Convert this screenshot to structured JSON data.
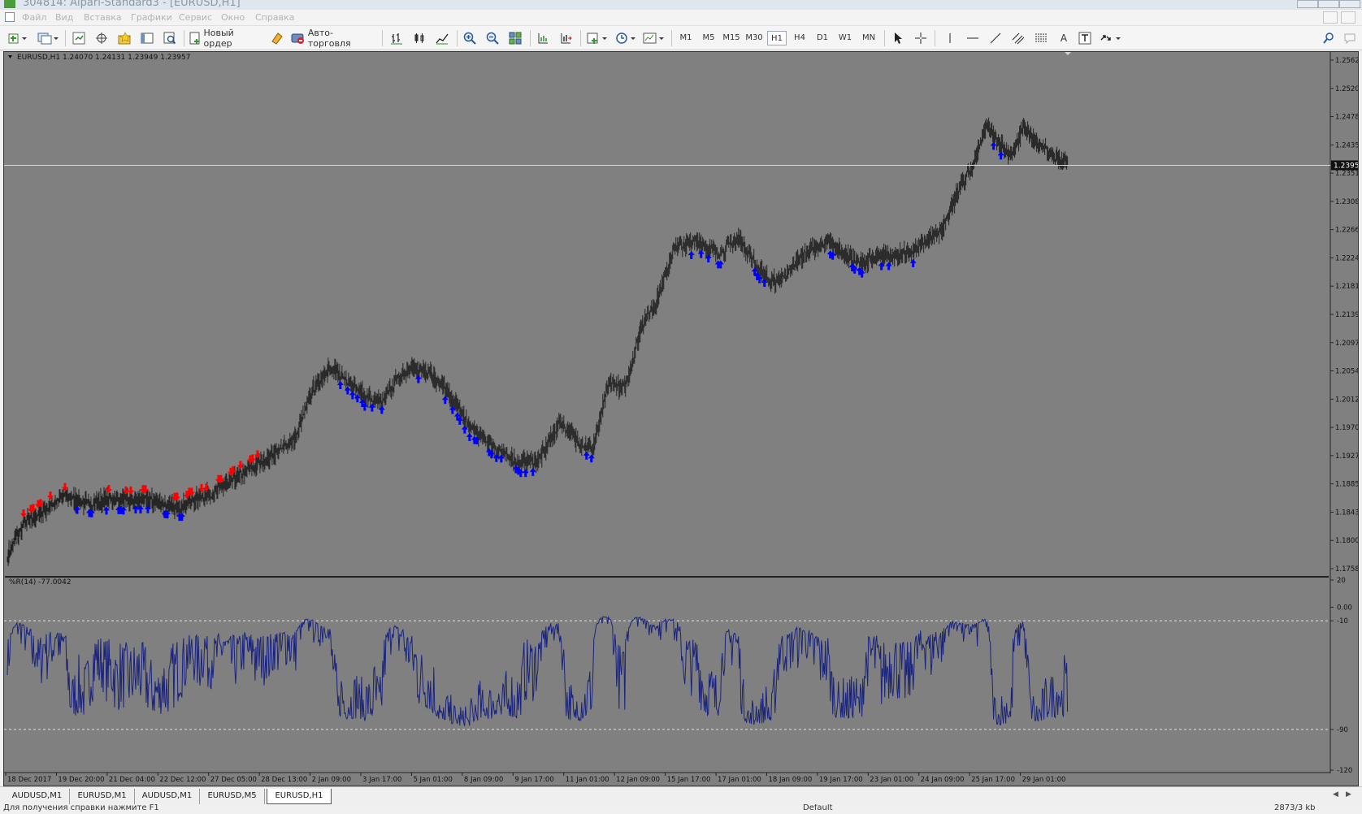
{
  "window": {
    "title": "304814: Alpari-Standard3 - [EURUSD,H1]"
  },
  "menu": {
    "items": [
      "Файл",
      "Вид",
      "Вставка",
      "Графики",
      "Сервис",
      "Окно",
      "Справка"
    ]
  },
  "toolbar": {
    "new_order_label": "Новый ордер",
    "auto_trading_label": "Авто-торговля",
    "timeframes": [
      "M1",
      "M5",
      "M15",
      "M30",
      "H1",
      "H4",
      "D1",
      "W1",
      "MN"
    ],
    "selected_timeframe": "H1",
    "text_tool_label": "A"
  },
  "chart": {
    "header": "EURUSD,H1  1.24070 1.24131 1.23949 1.23957",
    "current_price_label": "1.23957",
    "price_axis_labels": [
      "1.25620",
      "1.25200",
      "1.24780",
      "1.24350",
      "1.23510",
      "1.23080",
      "1.22660",
      "1.22240",
      "1.21810",
      "1.21390",
      "1.20970",
      "1.20540",
      "1.20120",
      "1.19700",
      "1.19270",
      "1.18850",
      "1.18430",
      "1.18000",
      "1.17580"
    ],
    "indicator_header": "%R(14) -77.0042",
    "indicator_axis_labels": [
      "20",
      "0.00",
      "-10",
      "-90",
      "-120"
    ],
    "time_axis_labels": [
      "18 Dec 2017",
      "19 Dec 20:00",
      "21 Dec 04:00",
      "22 Dec 12:00",
      "27 Dec 05:00",
      "28 Dec 13:00",
      "2 Jan 09:00",
      "3 Jan 17:00",
      "5 Jan 01:00",
      "8 Jan 09:00",
      "9 Jan 17:00",
      "11 Jan 01:00",
      "12 Jan 09:00",
      "15 Jan 17:00",
      "17 Jan 01:00",
      "18 Jan 09:00",
      "19 Jan 17:00",
      "23 Jan 01:00",
      "24 Jan 09:00",
      "25 Jan 17:00",
      "29 Jan 01:00"
    ],
    "colors": {
      "background": "#808080",
      "bars": "#222222",
      "buy_arrow": "#0000ff",
      "sell_arrow": "#ff0000",
      "indicator_line": "#1a237e",
      "level_line": "#e0e0e0"
    }
  },
  "chart_data": {
    "type": "line",
    "series": [
      {
        "name": "EURUSD,H1",
        "kind": "price",
        "x_start": "18 Dec 2017",
        "x_end": "29 Jan 01:00",
        "keypoints": [
          [
            0,
            1.178
          ],
          [
            20,
            1.183
          ],
          [
            45,
            1.185
          ],
          [
            70,
            1.1875
          ],
          [
            95,
            1.186
          ],
          [
            125,
            1.1868
          ],
          [
            150,
            1.1865
          ],
          [
            170,
            1.1868
          ],
          [
            185,
            1.1862
          ],
          [
            200,
            1.1855
          ],
          [
            215,
            1.1858
          ],
          [
            235,
            1.187
          ],
          [
            255,
            1.188
          ],
          [
            275,
            1.1895
          ],
          [
            290,
            1.191
          ],
          [
            310,
            1.1925
          ],
          [
            330,
            1.194
          ],
          [
            355,
            1.1965
          ],
          [
            375,
            1.204
          ],
          [
            395,
            1.2075
          ],
          [
            415,
            1.206
          ],
          [
            440,
            1.203
          ],
          [
            460,
            1.202
          ],
          [
            480,
            1.206
          ],
          [
            500,
            1.2075
          ],
          [
            520,
            1.207
          ],
          [
            545,
            1.203
          ],
          [
            570,
            1.198
          ],
          [
            600,
            1.195
          ],
          [
            630,
            1.1925
          ],
          [
            655,
            1.193
          ],
          [
            680,
            1.199
          ],
          [
            700,
            1.196
          ],
          [
            720,
            1.1945
          ],
          [
            740,
            1.205
          ],
          [
            760,
            1.2045
          ],
          [
            780,
            1.214
          ],
          [
            800,
            1.2185
          ],
          [
            820,
            1.2265
          ],
          [
            850,
            1.2275
          ],
          [
            875,
            1.2255
          ],
          [
            900,
            1.228
          ],
          [
            920,
            1.224
          ],
          [
            940,
            1.221
          ],
          [
            960,
            1.2225
          ],
          [
            980,
            1.2255
          ],
          [
            1010,
            1.2275
          ],
          [
            1030,
            1.2255
          ],
          [
            1050,
            1.224
          ],
          [
            1070,
            1.225
          ],
          [
            1090,
            1.2255
          ],
          [
            1110,
            1.2255
          ],
          [
            1130,
            1.2275
          ],
          [
            1150,
            1.2295
          ],
          [
            1170,
            1.2355
          ],
          [
            1190,
            1.24
          ],
          [
            1205,
            1.246
          ],
          [
            1220,
            1.243
          ],
          [
            1235,
            1.241
          ],
          [
            1250,
            1.2455
          ],
          [
            1270,
            1.2425
          ],
          [
            1290,
            1.241
          ],
          [
            1305,
            1.24
          ]
        ]
      },
      {
        "name": "%R(14)",
        "kind": "indicator",
        "levels": [
          -10,
          -90
        ],
        "range": [
          -120,
          20
        ]
      }
    ],
    "buy_signals_count_approx": 62,
    "sell_signals_count_approx": 27,
    "last_price": 1.23957,
    "last_indicator_value": -77.0042,
    "ylim_price": [
      1.1758,
      1.2562
    ],
    "ylim_indicator": [
      -120,
      20
    ]
  },
  "tabs": [
    {
      "label": "AUDUSD,M1"
    },
    {
      "label": "EURUSD,M1"
    },
    {
      "label": "AUDUSD,M1"
    },
    {
      "label": "EURUSD,M5"
    },
    {
      "label": "EURUSD,H1",
      "active": true
    }
  ],
  "status": {
    "left": "Для получения справки нажмите F1",
    "profile": "Default",
    "traffic": "2873/3 kb"
  }
}
